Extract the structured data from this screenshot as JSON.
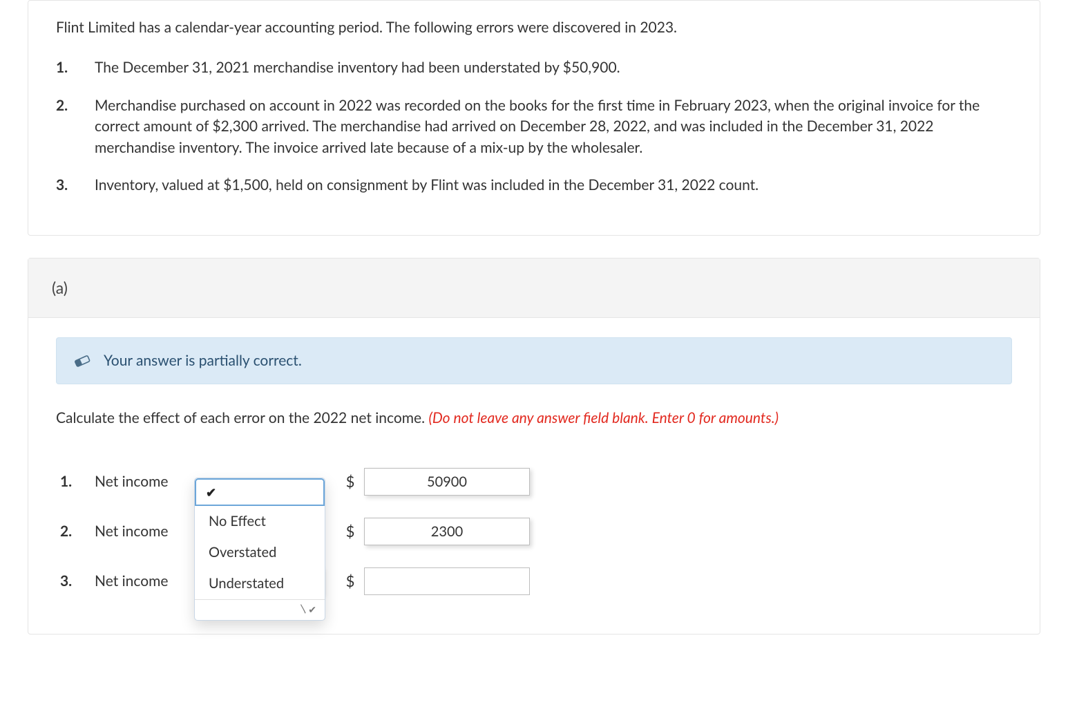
{
  "question": {
    "intro": "Flint Limited has a calendar-year accounting period. The following errors were discovered in 2023.",
    "items": [
      {
        "num": "1.",
        "text": "The December 31, 2021 merchandise inventory had been understated by $50,900."
      },
      {
        "num": "2.",
        "text": "Merchandise purchased on account in 2022 was recorded on the books for the first time in February 2023, when the original invoice for the correct amount of $2,300 arrived. The merchandise had arrived on December 28, 2022, and was included in the December 31, 2022 merchandise inventory. The invoice arrived late because of a mix-up by the wholesaler."
      },
      {
        "num": "3.",
        "text": "Inventory, valued at $1,500, held on consignment by Flint was included in the December 31, 2022 count."
      }
    ]
  },
  "part": {
    "label": "(a)",
    "banner": "Your answer is partially correct.",
    "instruction_plain": "Calculate the effect of each error on the 2022 net income. ",
    "instruction_warn": "(Do not leave any answer field blank. Enter 0 for amounts.)"
  },
  "dropdown": {
    "selected_mark": "✔",
    "options": [
      "No Effect",
      "Overstated",
      "Understated"
    ]
  },
  "rows": [
    {
      "num": "1.",
      "label": "Net income",
      "dollar": "$",
      "value": "50900",
      "select_state": "open"
    },
    {
      "num": "2.",
      "label": "Net income",
      "dollar": "$",
      "value": "2300",
      "select_state": "hidden"
    },
    {
      "num": "3.",
      "label": "Net income",
      "dollar": "$",
      "value": "",
      "select_state": "closed"
    }
  ]
}
